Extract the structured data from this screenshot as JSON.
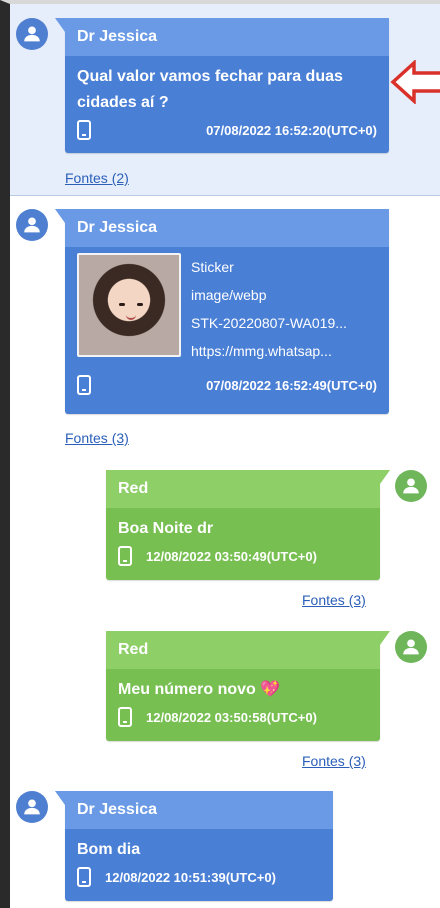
{
  "messages": [
    {
      "sender": "Dr Jessica",
      "text": "Qual valor vamos fechar para duas cidades aí ?",
      "timestamp": "07/08/2022 16:52:20(UTC+0)",
      "sources": "Fontes (2)"
    },
    {
      "sender": "Dr Jessica",
      "attachment": {
        "label": "Sticker",
        "mime": "image/webp",
        "filename": "STK-20220807-WA019...",
        "url": "https://mmg.whatsap..."
      },
      "timestamp": "07/08/2022 16:52:49(UTC+0)",
      "sources": "Fontes (3)"
    },
    {
      "sender": "Red",
      "text": "Boa Noite dr",
      "timestamp": "12/08/2022 03:50:49(UTC+0)",
      "sources": "Fontes (3)"
    },
    {
      "sender": "Red",
      "text": "Meu número novo 💖",
      "timestamp": "12/08/2022 03:50:58(UTC+0)",
      "sources": "Fontes (3)"
    },
    {
      "sender": "Dr Jessica",
      "text": "Bom dia",
      "timestamp": "12/08/2022 10:51:39(UTC+0)"
    }
  ],
  "colors": {
    "incoming_bubble": "#4a7fd6",
    "outgoing_bubble": "#78bf52",
    "highlight": "#e6eefb",
    "annotation_arrow": "#d9302a"
  },
  "icons": {
    "avatar": "user-avatar-icon",
    "device": "phone-icon",
    "pointer": "red-arrow-icon"
  }
}
